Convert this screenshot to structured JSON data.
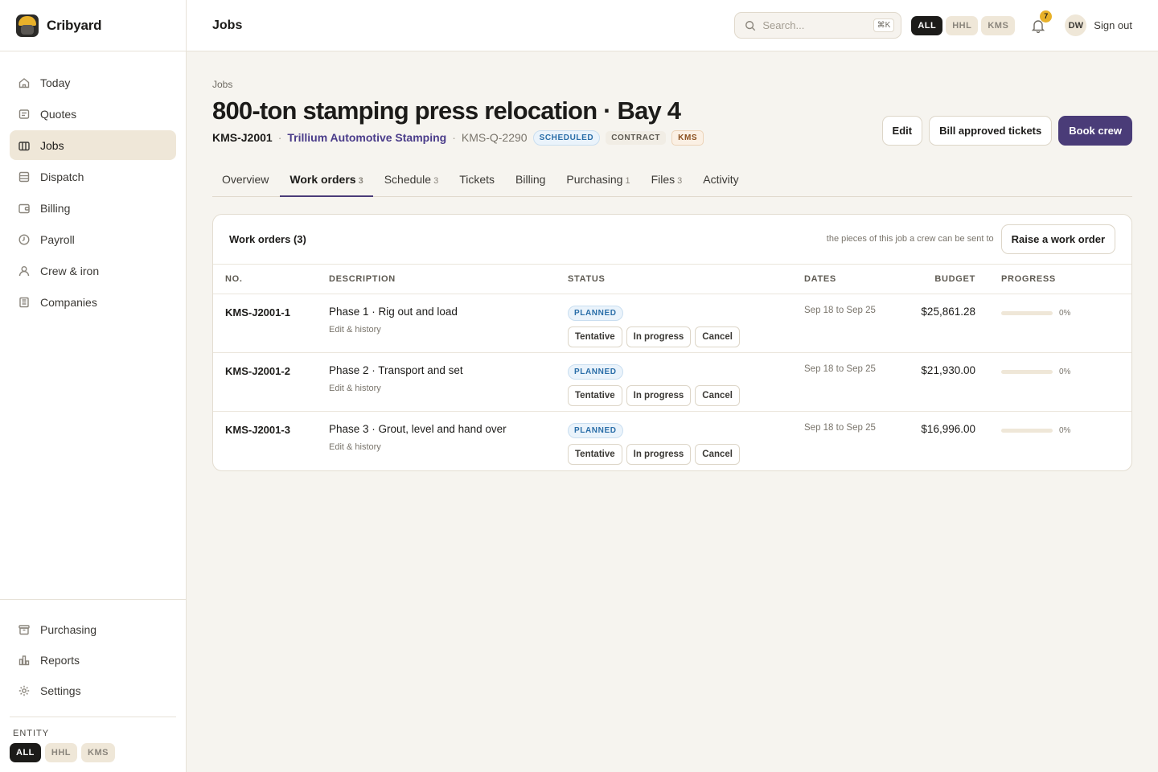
{
  "app": {
    "name": "Cribyard"
  },
  "sidebar": {
    "items": [
      {
        "label": "Today",
        "icon": "home-icon"
      },
      {
        "label": "Quotes",
        "icon": "document-icon"
      },
      {
        "label": "Jobs",
        "icon": "briefcase-icon",
        "active": true
      },
      {
        "label": "Dispatch",
        "icon": "grid-icon"
      },
      {
        "label": "Billing",
        "icon": "wallet-icon"
      },
      {
        "label": "Payroll",
        "icon": "clock-icon"
      },
      {
        "label": "Crew & iron",
        "icon": "user-icon"
      },
      {
        "label": "Companies",
        "icon": "building-icon"
      }
    ],
    "bottom_items": [
      {
        "label": "Purchasing",
        "icon": "archive-icon"
      },
      {
        "label": "Reports",
        "icon": "chart-icon"
      },
      {
        "label": "Settings",
        "icon": "gear-icon"
      }
    ],
    "entity_label": "ENTITY",
    "entity_chips": [
      "ALL",
      "HHL",
      "KMS"
    ],
    "entity_selected": "ALL"
  },
  "topbar": {
    "title": "Jobs",
    "search_placeholder": "Search...",
    "search_shortcut": "⌘K",
    "chips": [
      "ALL",
      "HHL",
      "KMS"
    ],
    "chips_selected": "ALL",
    "notifications": "7",
    "avatar_initials": "DW",
    "signout": "Sign out"
  },
  "page": {
    "breadcrumb": "Jobs",
    "title": "800-ton stamping press relocation · Bay 4",
    "job_id": "KMS-J2001",
    "company": "Trillium Automotive Stamping",
    "quote_id": "KMS-Q-2290",
    "badges": {
      "status": "SCHEDULED",
      "type": "CONTRACT",
      "entity": "KMS"
    },
    "actions": {
      "edit": "Edit",
      "bill": "Bill approved tickets",
      "book": "Book crew"
    }
  },
  "tabs": [
    {
      "label": "Overview",
      "count": ""
    },
    {
      "label": "Work orders",
      "count": "3",
      "active": true
    },
    {
      "label": "Schedule",
      "count": "3"
    },
    {
      "label": "Tickets",
      "count": ""
    },
    {
      "label": "Billing",
      "count": ""
    },
    {
      "label": "Purchasing",
      "count": "1"
    },
    {
      "label": "Files",
      "count": "3"
    },
    {
      "label": "Activity",
      "count": ""
    }
  ],
  "work_orders": {
    "title": "Work orders (3)",
    "hint": "the pieces of this job a crew can be sent to",
    "raise_button": "Raise a work order",
    "columns": {
      "no": "NO.",
      "description": "DESCRIPTION",
      "status": "STATUS",
      "dates": "DATES",
      "budget": "BUDGET",
      "progress": "PROGRESS"
    },
    "status_actions": {
      "tentative": "Tentative",
      "in_progress": "In progress",
      "cancel": "Cancel"
    },
    "rows": [
      {
        "no": "KMS-J2001-1",
        "description": "Phase 1 · Rig out and load",
        "edit": "Edit & history",
        "status": "PLANNED",
        "dates": "Sep 18 to Sep 25",
        "budget": "$25,861.28",
        "progress": 0,
        "progress_label": "0%"
      },
      {
        "no": "KMS-J2001-2",
        "description": "Phase 2 · Transport and set",
        "edit": "Edit & history",
        "status": "PLANNED",
        "dates": "Sep 18 to Sep 25",
        "budget": "$21,930.00",
        "progress": 0,
        "progress_label": "0%"
      },
      {
        "no": "KMS-J2001-3",
        "description": "Phase 3 · Grout, level and hand over",
        "edit": "Edit & history",
        "status": "PLANNED",
        "dates": "Sep 18 to Sep 25",
        "budget": "$16,996.00",
        "progress": 0,
        "progress_label": "0%"
      }
    ]
  }
}
